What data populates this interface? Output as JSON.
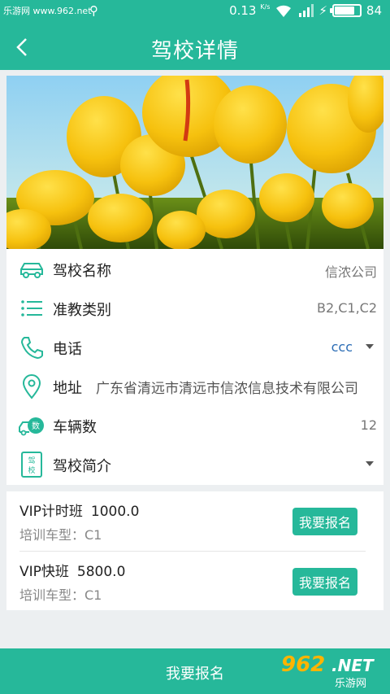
{
  "status_bar": {
    "watermark": "乐游网 www.962.net",
    "speed": "0.13",
    "speed_unit": "K/s",
    "battery": "84"
  },
  "header": {
    "title": "驾校详情"
  },
  "info": {
    "school_name_label": "驾校名称",
    "school_name_value": "信浓公司",
    "license_label": "准教类别",
    "license_value": "B2,C1,C2",
    "phone_label": "电话",
    "phone_value": "ccc",
    "address_label": "地址",
    "address_value": "广东省清远市清远市信浓信息技术有限公司",
    "vehicles_label": "车辆数",
    "vehicles_value": "12",
    "intro_label": "驾校简介",
    "intro_icon_text": "驾校"
  },
  "courses": [
    {
      "name": "VIP计时班",
      "price": "1000.0",
      "car_type": "培训车型：C1",
      "button": "我要报名"
    },
    {
      "name": "VIP快班",
      "price": "5800.0",
      "car_type": "培训车型：C1",
      "button": "我要报名"
    }
  ],
  "bottom": {
    "enroll_label": "我要报名",
    "logo_number": "962",
    "logo_net": ".NET",
    "logo_cn": "乐游网"
  },
  "colors": {
    "primary": "#26b89a",
    "link": "#2a6cb5"
  }
}
